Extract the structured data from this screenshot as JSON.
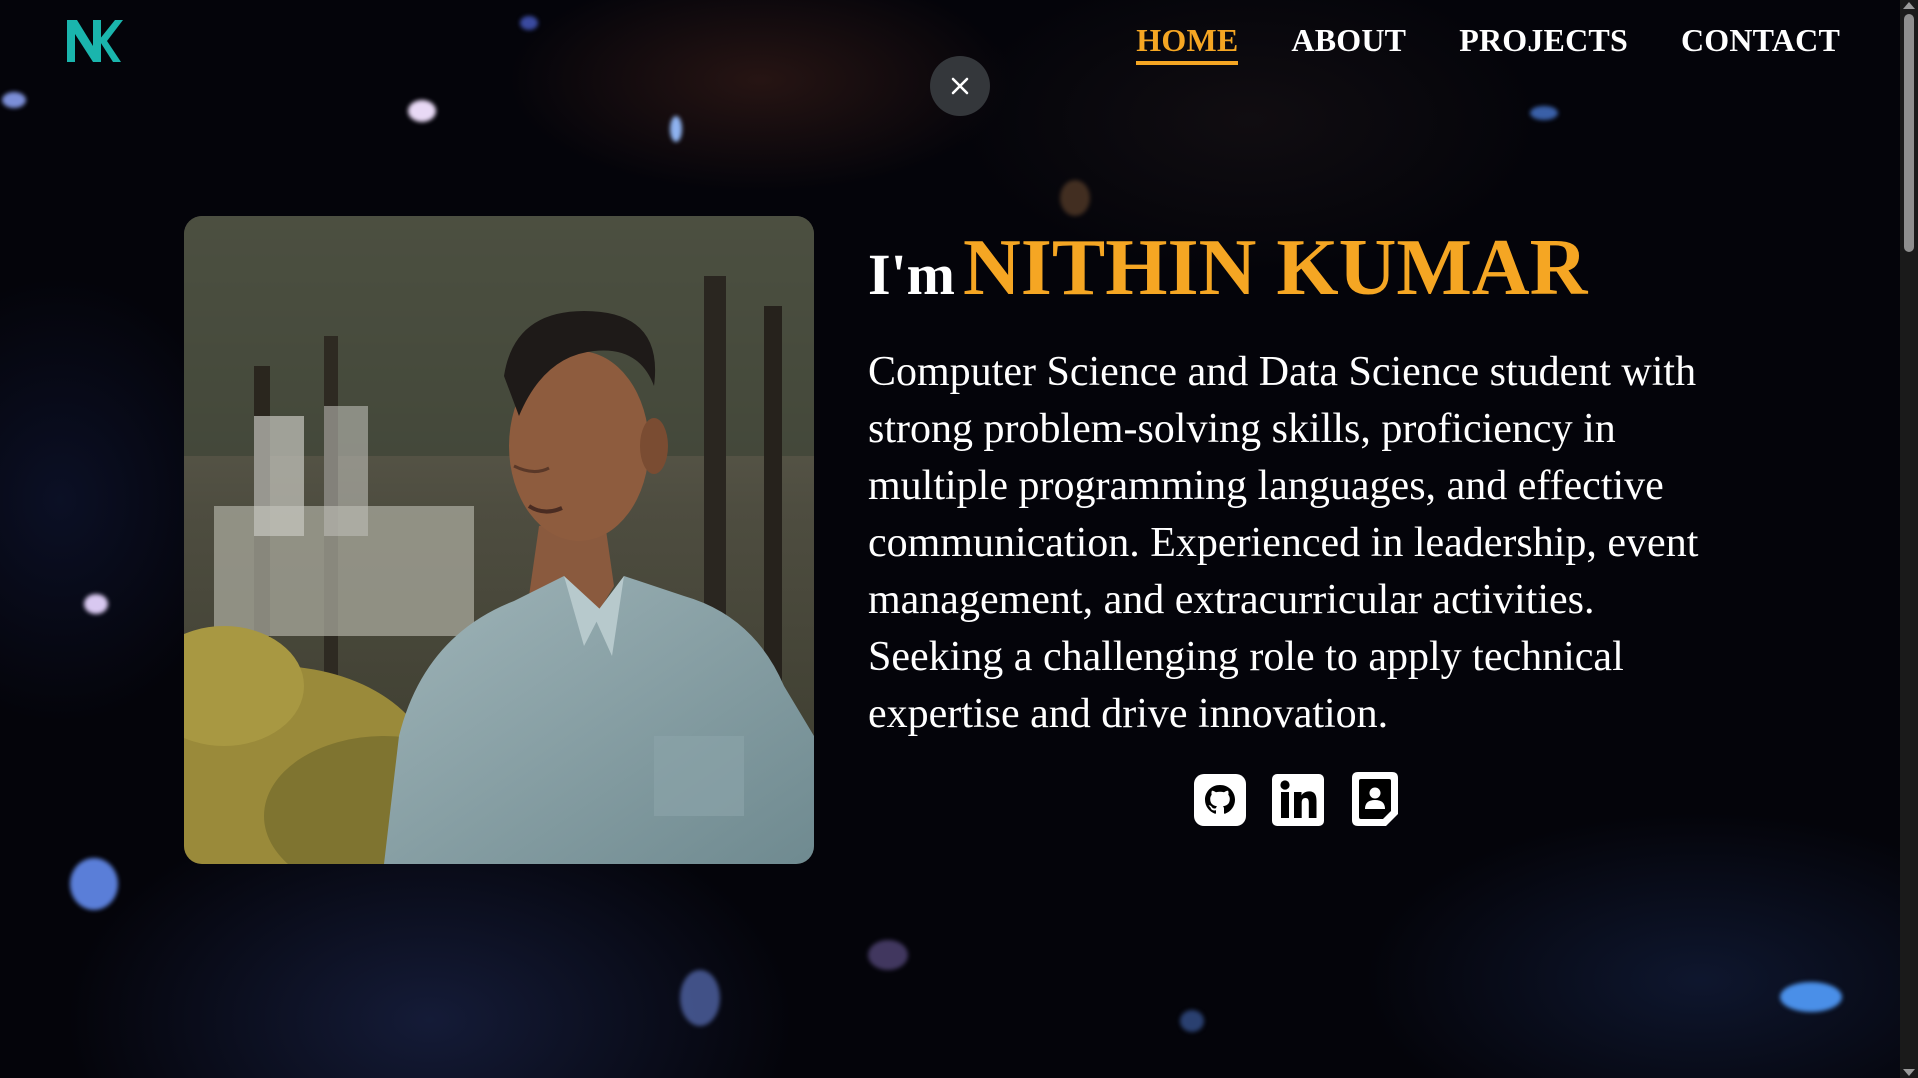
{
  "logo": {
    "icon": "nk-logo-icon",
    "color": "#1ab5ad"
  },
  "nav": {
    "items": [
      {
        "label": "HOME",
        "active": true
      },
      {
        "label": "ABOUT",
        "active": false
      },
      {
        "label": "PROJECTS",
        "active": false
      },
      {
        "label": "CONTACT",
        "active": false
      }
    ]
  },
  "close_button": {
    "icon": "close-icon"
  },
  "hero": {
    "greeting": "I'm",
    "name": "NITHIN KUMAR",
    "bio": "Computer Science and Data Science student with strong problem-solving skills, proficiency in multiple programming languages, and effective communication. Experienced in leadership, event management, and extracurricular activities. Seeking a challenging role to apply technical expertise and drive innovation.",
    "photo_icon": "profile-photo"
  },
  "socials": [
    {
      "icon": "github-icon"
    },
    {
      "icon": "linkedin-icon"
    },
    {
      "icon": "resume-icon"
    }
  ],
  "colors": {
    "accent": "#f5a623",
    "background": "#04040a",
    "text": "#ffffff",
    "logo": "#1ab5ad"
  }
}
